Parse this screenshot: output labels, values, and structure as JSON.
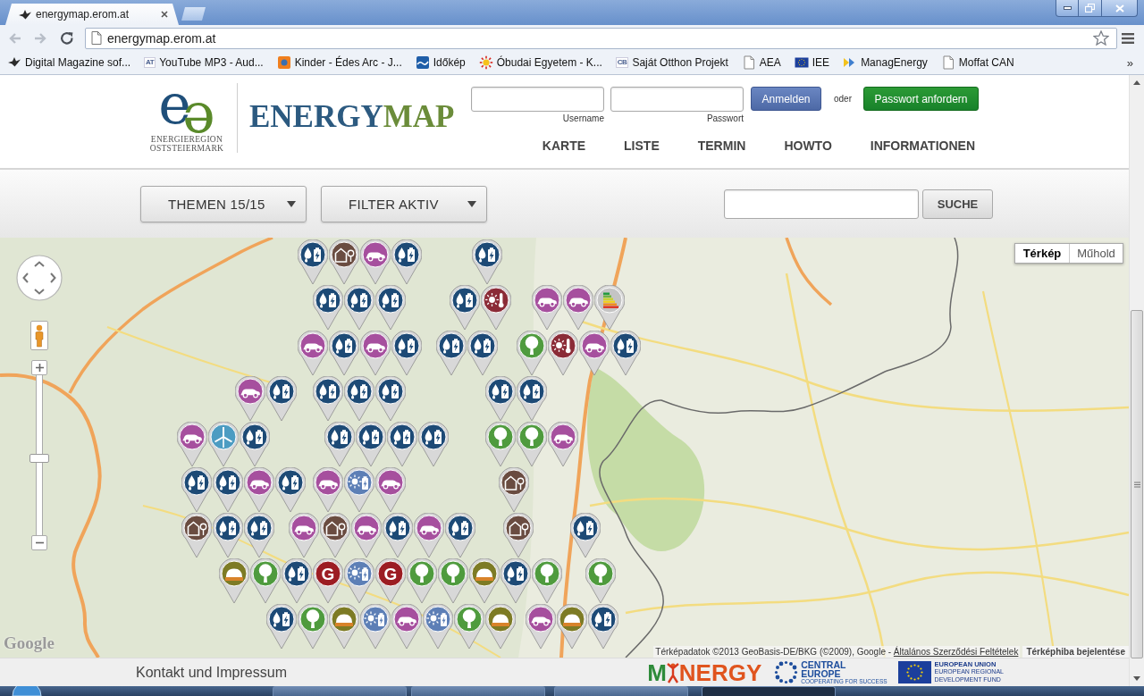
{
  "browser": {
    "tab": {
      "title": "energymap.erom.at"
    },
    "back": {
      "disabled": true
    },
    "forward": {
      "disabled": true
    },
    "address": "energymap.erom.at",
    "bookmarks": [
      {
        "label": "Digital Magazine sof...",
        "kind": "bird"
      },
      {
        "label": "YouTube MP3 - Aud...",
        "kind": "letters",
        "badge": "AT"
      },
      {
        "label": "Kinder - Édes Arc - J...",
        "kind": "square"
      },
      {
        "label": "Időkép",
        "kind": "wave"
      },
      {
        "label": "Óbudai Egyetem - K...",
        "kind": "sun"
      },
      {
        "label": "Saját Otthon Projekt",
        "kind": "letters",
        "badge": "CB"
      },
      {
        "label": "AEA",
        "kind": "page"
      },
      {
        "label": "IEE",
        "kind": "flag"
      },
      {
        "label": "ManagEnergy",
        "kind": "arrows"
      },
      {
        "label": "Moffat CAN",
        "kind": "page"
      }
    ],
    "bookmarks_overflow": "»"
  },
  "header": {
    "logo": {
      "mark_left": "e",
      "mark_right": "ə",
      "lines": [
        "ENERGIEREGION",
        "OSTSTEIERMARK"
      ]
    },
    "title": {
      "first": "ENERGY",
      "second": "MAP"
    },
    "login": {
      "username_label": "Username",
      "password_label": "Passwort",
      "submit": "Anmelden",
      "separator": "oder",
      "request": "Passwort anfordern"
    },
    "nav": [
      {
        "label": "KARTE"
      },
      {
        "label": "LISTE"
      },
      {
        "label": "TERMIN"
      },
      {
        "label": "HOWTO"
      },
      {
        "label": "INFORMATIONEN"
      }
    ]
  },
  "filter_bar": {
    "dropdowns": [
      {
        "label": "THEMEN 15/15"
      },
      {
        "label": "FILTER AKTIV"
      }
    ],
    "search_button": "SUCHE"
  },
  "map": {
    "type_buttons": [
      {
        "label": "Térkép",
        "selected": true
      },
      {
        "label": "Műhold",
        "selected": false
      }
    ],
    "zoom": {
      "level": 0.48
    },
    "logo": "Google",
    "attribution": "Térképadatok ©2013 GeoBasis-DE/BKG (©2009), Google -",
    "terms_link": "Általános Szerződési Feltételek",
    "report_link": "Térképhiba bejelentése",
    "markers": [
      {
        "kind": "water",
        "color": "#1d4a76"
      },
      {
        "kind": "house",
        "color": "#6a4c41"
      },
      {
        "kind": "car",
        "color": "#a64f9e"
      },
      {
        "kind": "water",
        "color": "#1d4a76"
      },
      {
        "kind": "water",
        "color": "#1d4a76"
      },
      {
        "kind": "water",
        "color": "#1d4a76"
      },
      {
        "kind": "water",
        "color": "#1d4a76"
      },
      {
        "kind": "water",
        "color": "#1d4a76"
      },
      {
        "kind": "water",
        "color": "#1d4a76"
      },
      {
        "kind": "thermo",
        "color": "#8b2b37"
      },
      {
        "kind": "car",
        "color": "#a64f9e"
      },
      {
        "kind": "car",
        "color": "#a64f9e"
      },
      {
        "kind": "label",
        "color": "#c4c4c4"
      },
      {
        "kind": "car",
        "color": "#a64f9e"
      },
      {
        "kind": "water",
        "color": "#1d4a76"
      },
      {
        "kind": "car",
        "color": "#a64f9e"
      },
      {
        "kind": "water",
        "color": "#1d4a76"
      },
      {
        "kind": "water",
        "color": "#1d4a76"
      },
      {
        "kind": "water",
        "color": "#1d4a76"
      },
      {
        "kind": "tree",
        "color": "#4f9b3e"
      },
      {
        "kind": "thermo",
        "color": "#8b2b37"
      },
      {
        "kind": "car",
        "color": "#a64f9e"
      },
      {
        "kind": "water",
        "color": "#1d4a76"
      },
      {
        "kind": "car",
        "color": "#a64f9e"
      },
      {
        "kind": "water",
        "color": "#1d4a76"
      },
      {
        "kind": "water",
        "color": "#1d4a76"
      },
      {
        "kind": "water",
        "color": "#1d4a76"
      },
      {
        "kind": "water",
        "color": "#1d4a76"
      },
      {
        "kind": "water",
        "color": "#1d4a76"
      },
      {
        "kind": "water",
        "color": "#1d4a76"
      },
      {
        "kind": "car",
        "color": "#a64f9e"
      },
      {
        "kind": "wind",
        "color": "#4c9cc2"
      },
      {
        "kind": "water",
        "color": "#1d4a76"
      },
      {
        "kind": "water",
        "color": "#1d4a76"
      },
      {
        "kind": "water",
        "color": "#1d4a76"
      },
      {
        "kind": "water",
        "color": "#1d4a76"
      },
      {
        "kind": "water",
        "color": "#1d4a76"
      },
      {
        "kind": "tree",
        "color": "#4f9b3e"
      },
      {
        "kind": "tree",
        "color": "#4f9b3e"
      },
      {
        "kind": "car",
        "color": "#a64f9e"
      },
      {
        "kind": "water",
        "color": "#1d4a76"
      },
      {
        "kind": "water",
        "color": "#1d4a76"
      },
      {
        "kind": "car",
        "color": "#a64f9e"
      },
      {
        "kind": "water",
        "color": "#1d4a76"
      },
      {
        "kind": "car",
        "color": "#a64f9e"
      },
      {
        "kind": "solar",
        "color": "#5d7fb6"
      },
      {
        "kind": "car",
        "color": "#a64f9e"
      },
      {
        "kind": "house",
        "color": "#6a4c41"
      },
      {
        "kind": "house",
        "color": "#6a4c41"
      },
      {
        "kind": "water",
        "color": "#1d4a76"
      },
      {
        "kind": "water",
        "color": "#1d4a76"
      },
      {
        "kind": "car",
        "color": "#a64f9e"
      },
      {
        "kind": "house",
        "color": "#6a4c41"
      },
      {
        "kind": "car",
        "color": "#a64f9e"
      },
      {
        "kind": "water",
        "color": "#1d4a76"
      },
      {
        "kind": "car",
        "color": "#a64f9e"
      },
      {
        "kind": "water",
        "color": "#1d4a76"
      },
      {
        "kind": "house",
        "color": "#6a4c41"
      },
      {
        "kind": "water",
        "color": "#1d4a76"
      },
      {
        "kind": "biogas",
        "color": "#7d7b25"
      },
      {
        "kind": "tree",
        "color": "#4f9b3e"
      },
      {
        "kind": "water",
        "color": "#1d4a76"
      },
      {
        "kind": "gas",
        "color": "#9c1c23",
        "label": "G"
      },
      {
        "kind": "solar",
        "color": "#5d7fb6"
      },
      {
        "kind": "gas",
        "color": "#9c1c23",
        "label": "G"
      },
      {
        "kind": "tree",
        "color": "#4f9b3e"
      },
      {
        "kind": "tree",
        "color": "#4f9b3e"
      },
      {
        "kind": "biogas",
        "color": "#7d7b25"
      },
      {
        "kind": "water",
        "color": "#1d4a76"
      },
      {
        "kind": "tree",
        "color": "#4f9b3e"
      },
      {
        "kind": "tree",
        "color": "#4f9b3e"
      },
      {
        "kind": "water",
        "color": "#1d4a76"
      },
      {
        "kind": "tree",
        "color": "#4f9b3e"
      },
      {
        "kind": "biogas",
        "color": "#7d7b25"
      },
      {
        "kind": "solar",
        "color": "#5d7fb6"
      },
      {
        "kind": "car",
        "color": "#a64f9e"
      },
      {
        "kind": "solar",
        "color": "#5d7fb6"
      },
      {
        "kind": "tree",
        "color": "#4f9b3e"
      },
      {
        "kind": "biogas",
        "color": "#7d7b25"
      },
      {
        "kind": "car",
        "color": "#a64f9e"
      },
      {
        "kind": "biogas",
        "color": "#7d7b25"
      },
      {
        "kind": "water",
        "color": "#1d4a76"
      }
    ]
  },
  "footer": {
    "link": "Kontakt und Impressum",
    "partners": {
      "manergy": {
        "start": "M",
        "end": "NERGY"
      },
      "central_europe": {
        "lines": [
          "CENTRAL",
          "EUROPE"
        ],
        "tagline": "COOPERATING FOR SUCCESS"
      },
      "eu": {
        "lines": [
          "EUROPEAN UNION",
          "EUROPEAN REGIONAL",
          "DEVELOPMENT FUND"
        ]
      }
    }
  }
}
